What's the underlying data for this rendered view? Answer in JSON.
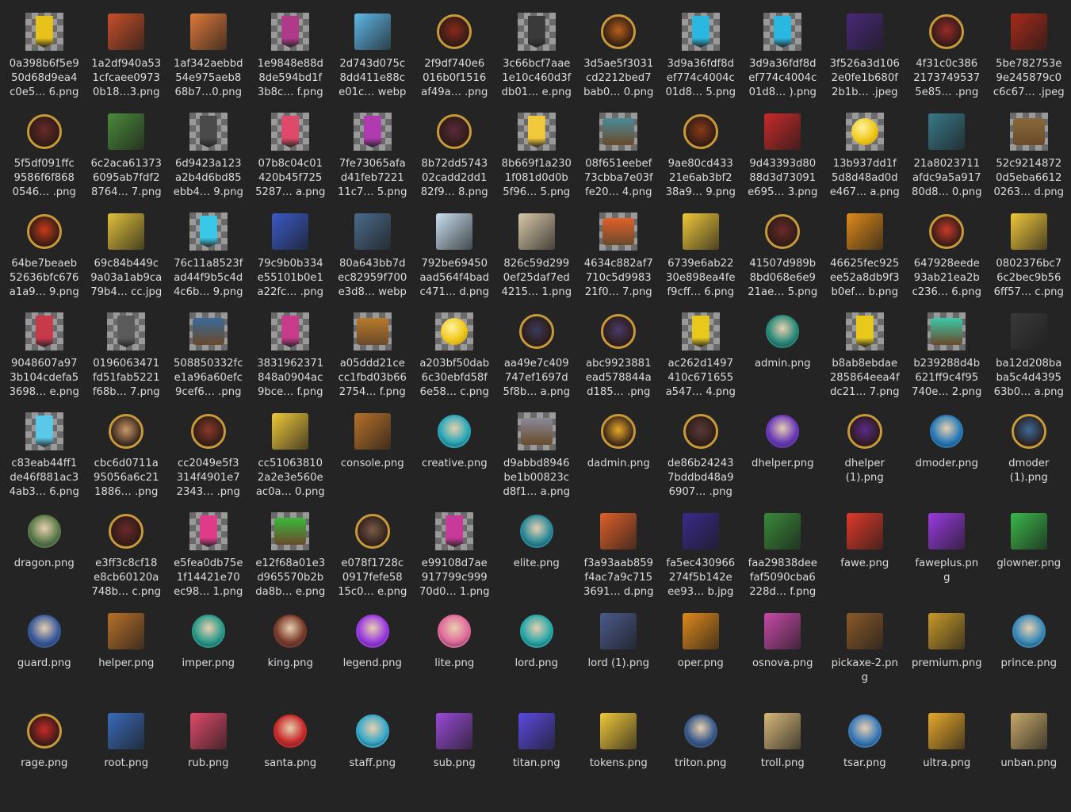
{
  "files": [
    {
      "name": "0a398b6f5e9\n50d68d9ea4\nc0e5… 6.png",
      "icon": "banner-icon",
      "color": "#e8c21a"
    },
    {
      "name": "1a2df940a53\n1cfcaee0973\n0b18…3.png",
      "icon": "character-art-icon",
      "color": "#c8502a"
    },
    {
      "name": "1af342aebbd\n54e975aeb8\n68b7…0.png",
      "icon": "logo-art-icon",
      "color": "#e07a3a"
    },
    {
      "name": "1e9848e88d\n8de594bd1f\n3b8c… f.png",
      "icon": "banner-icon",
      "color": "#b03a8a"
    },
    {
      "name": "2d743d075c\n8dd411e88c\ne01c… webp",
      "icon": "character-art-icon",
      "color": "#5fb8e8"
    },
    {
      "name": "2f9df740e6\n016b0f1516\naf49a… .png",
      "icon": "badge-icon",
      "color": "#8a2a1a"
    },
    {
      "name": "3c66bcf7aae\n1e10c460d3f\ndb01… e.png",
      "icon": "banner-icon",
      "color": "#3a3a3a"
    },
    {
      "name": "3d5ae5f3031\ncd2212bed7\nbab0… 0.png",
      "icon": "badge-icon",
      "color": "#b8601a"
    },
    {
      "name": "3d9a36fdf8d\nef774c4004c\n01d8… 5.png",
      "icon": "banner-icon",
      "color": "#2ab8e0"
    },
    {
      "name": "3d9a36fdf8d\nef774c4004c\n01d8… ).png",
      "icon": "banner-icon",
      "color": "#2ab8e0"
    },
    {
      "name": "3f526a3d106\n2e0fe1b680f\n2b1b… .jpeg",
      "icon": "character-art-icon",
      "color": "#4a2a7a"
    },
    {
      "name": "4f31c0c386\n2173749537\n5e85… .png",
      "icon": "badge-icon",
      "color": "#9a2a2a"
    },
    {
      "name": "5be782753e\n9e245879c0\nc6c67… .jpeg",
      "icon": "character-art-icon",
      "color": "#a82a1a"
    },
    {
      "name": "5f5df091ffc\n9586f6f868\n0546… .png",
      "icon": "badge-icon",
      "color": "#6a2a2a"
    },
    {
      "name": "6c2aca61373\n6095ab7fdf2\n8764… 7.png",
      "icon": "character-art-icon",
      "color": "#4a8a3a"
    },
    {
      "name": "6d9423a123\na2b4d6bd85\nebb4… 9.png",
      "icon": "banner-icon",
      "color": "#4a4a4a"
    },
    {
      "name": "07b8c04c01\n420b45f725\n5287… a.png",
      "icon": "banner-icon",
      "color": "#e04a6a"
    },
    {
      "name": "7fe73065afa\nd41feb7221\n11c7… 5.png",
      "icon": "banner-icon",
      "color": "#b03ab0"
    },
    {
      "name": "8b72dd5743\n02cadd2dd1\n82f9… 8.png",
      "icon": "badge-icon",
      "color": "#5a2a3a"
    },
    {
      "name": "8b669f1a230\n1f081d0d0b\n5f96… 5.png",
      "icon": "banner-icon",
      "color": "#f0c83a"
    },
    {
      "name": "08f651eebef\n73cbba7e03f\nfe20… 4.png",
      "icon": "chest-icon",
      "color": "#4a8a9a"
    },
    {
      "name": "9ae80cd433\n21e6ab3bf2\n38a9… 9.png",
      "icon": "badge-icon",
      "color": "#8a3a1a"
    },
    {
      "name": "9d43393d80\n88d3d73091\ne695… 3.png",
      "icon": "character-art-icon",
      "color": "#c82a2a"
    },
    {
      "name": "13b937dd1f\n5d8d48ad0d\ne467… a.png",
      "icon": "coin-icon",
      "color": "#f0c81a"
    },
    {
      "name": "21a8023711\nafdc9a5a917\n80d8… 0.png",
      "icon": "character-art-icon",
      "color": "#3a7a8a"
    },
    {
      "name": "52c9214872\n0d5eba6612\n0263… d.png",
      "icon": "chest-icon",
      "color": "#8a6a3a"
    },
    {
      "name": "64be7beaeb\n52636bfc676\na1a9… 9.png",
      "icon": "badge-icon",
      "color": "#c83a1a"
    },
    {
      "name": "69c84b449c\n9a03a1ab9ca\n79b4… cc.jpg",
      "icon": "character-art-icon",
      "color": "#e0c03a"
    },
    {
      "name": "76c11a8523f\nad44f9b5c4d\n4c6b… 9.png",
      "icon": "banner-icon",
      "color": "#3ac8e8"
    },
    {
      "name": "79c9b0b334\ne55101b0e1\na22fc… .png",
      "icon": "card-icon",
      "color": "#3a5ac8"
    },
    {
      "name": "80a643bb7d\nec82959f700\ne3d8… webp",
      "icon": "shark-icon",
      "color": "#4a6a8a"
    },
    {
      "name": "792be69450\naad564f4bad\nc471… d.png",
      "icon": "character-art-icon",
      "color": "#c8e0f0"
    },
    {
      "name": "826c59d299\n0ef25daf7ed\n4215… 1.png",
      "icon": "scroll-icon",
      "color": "#d8c8a8"
    },
    {
      "name": "4634c882af7\n710c5d9983\n21f0… 7.png",
      "icon": "chest-icon",
      "color": "#e0602a"
    },
    {
      "name": "6739e6ab22\n30e898ea4fe\nf9cff… 6.png",
      "icon": "coins-pile-icon",
      "color": "#f0c83a"
    },
    {
      "name": "41507d989b\n8bd068e6e9\n21ae… 5.png",
      "icon": "badge-icon",
      "color": "#6a2a2a"
    },
    {
      "name": "46625fec925\nee52a8db9f3\nb0ef… b.png",
      "icon": "sign-icon",
      "color": "#e08a1a"
    },
    {
      "name": "647928eede\n93ab21ea2b\nc236… 6.png",
      "icon": "badge-icon",
      "color": "#c83a2a"
    },
    {
      "name": "0802376bc7\n6c2bec9b56\n6ff57… c.png",
      "icon": "coins-pile-icon",
      "color": "#f0c83a"
    },
    {
      "name": "9048607a97\n3b104cdefa5\n3698… e.png",
      "icon": "banner-icon",
      "color": "#c83a4a"
    },
    {
      "name": "0196063471\nfd51fab5221\nf68b… 7.png",
      "icon": "banner-icon",
      "color": "#5a5a5a"
    },
    {
      "name": "508850332fc\ne1a96a60efc\n9cef6… .png",
      "icon": "chest-icon",
      "color": "#3a6a9a"
    },
    {
      "name": "3831962371\n848a0904ac\n9bce… f.png",
      "icon": "banner-icon",
      "color": "#c83a8a"
    },
    {
      "name": "a05ddd21ce\ncc1fbd03b66\n2754… f.png",
      "icon": "chest-icon",
      "color": "#b87a2a"
    },
    {
      "name": "a203bf50dab\n6c30ebfd58f\n6e58… c.png",
      "icon": "coin-icon",
      "color": "#f0c81a"
    },
    {
      "name": "aa49e7c409\n747ef1697d\n5f8b… a.png",
      "icon": "badge-icon",
      "color": "#3a3a5a"
    },
    {
      "name": "abc9923881\nead578844a\nd185… .png",
      "icon": "badge-icon",
      "color": "#4a3a6a"
    },
    {
      "name": "ac262d1497\n410c671655\na547… 4.png",
      "icon": "banner-icon",
      "color": "#e8c81a"
    },
    {
      "name": "admin.png",
      "icon": "round-avatar-icon",
      "color": "#2a8a7a"
    },
    {
      "name": "b8ab8ebdae\n285864eea4f\ndc21… 7.png",
      "icon": "banner-icon",
      "color": "#e8c81a"
    },
    {
      "name": "b239288d4b\n621ff9c4f95\n740e… 2.png",
      "icon": "chest-icon",
      "color": "#3ac8a8"
    },
    {
      "name": "ba12d208ba\nba5c4d4395\n63b0… a.png",
      "icon": "anvil-icon",
      "color": "#3a3a3a"
    },
    {
      "name": "c83eab44ff1\nde46f881ac3\n4ab3… 6.png",
      "icon": "banner-icon",
      "color": "#5ac8e8"
    },
    {
      "name": "cbc6d0711a\n95056a6c21\n1886… .png",
      "icon": "badge-icon",
      "color": "#c89a6a"
    },
    {
      "name": "cc2049e5f3\n314f4901e7\n2343… .png",
      "icon": "badge-icon",
      "color": "#8a3a2a"
    },
    {
      "name": "cc51063810\n2a2e3e560e\nac0a… 0.png",
      "icon": "coins-pile-icon",
      "color": "#f0c83a"
    },
    {
      "name": "console.png",
      "icon": "gingerbread-icon",
      "color": "#b8702a"
    },
    {
      "name": "creative.png",
      "icon": "round-avatar-icon",
      "color": "#2aa8b8"
    },
    {
      "name": "d9abbd8946\nbe1b00823c\nd8f1… a.png",
      "icon": "chest-icon",
      "color": "#8a8a9a"
    },
    {
      "name": "dadmin.png",
      "icon": "badge-icon",
      "color": "#e8a82a"
    },
    {
      "name": "de86b24243\n7bddbd48a9\n6907… .png",
      "icon": "badge-icon",
      "color": "#5a3a3a"
    },
    {
      "name": "dhelper.png",
      "icon": "hexagon-avatar-icon",
      "color": "#6a3ab8"
    },
    {
      "name": "dhelper\n(1).png",
      "icon": "badge-icon",
      "color": "#5a2a8a"
    },
    {
      "name": "dmoder.png",
      "icon": "round-avatar-icon",
      "color": "#2a7ab8"
    },
    {
      "name": "dmoder\n(1).png",
      "icon": "badge-icon",
      "color": "#3a6a9a"
    },
    {
      "name": "dragon.png",
      "icon": "round-avatar-icon",
      "color": "#5a7a4a"
    },
    {
      "name": "e3ff3c8cf18\ne8cb60120a\n748b… c.png",
      "icon": "badge-icon",
      "color": "#6a2a2a"
    },
    {
      "name": "e5fea0db75e\n1f14421e70\nec98… 1.png",
      "icon": "banner-icon",
      "color": "#e03a8a"
    },
    {
      "name": "e12f68a01e3\nd965570b2b\nda8b… e.png",
      "icon": "chest-icon",
      "color": "#3ab83a"
    },
    {
      "name": "e078f1728c\n0917fefe58\n15c0… e.png",
      "icon": "badge-icon",
      "color": "#7a5a4a"
    },
    {
      "name": "e99108d7ae\n917799c999\n70d0… 1.png",
      "icon": "banner-icon",
      "color": "#c83a9a"
    },
    {
      "name": "elite.png",
      "icon": "round-avatar-icon",
      "color": "#2a8a9a"
    },
    {
      "name": "f3a93aab859\nf4ac7a9c715\n3691… d.png",
      "icon": "logo-art-icon",
      "color": "#e0602a"
    },
    {
      "name": "fa5ec430966\n274f5b142e\nee93… b.jpg",
      "icon": "character-art-icon",
      "color": "#3a2a8a"
    },
    {
      "name": "faa29838dee\nfaf5090cba6\n228d… f.png",
      "icon": "character-art-icon",
      "color": "#3a8a3a"
    },
    {
      "name": "fawe.png",
      "icon": "gift-icon",
      "color": "#e03a2a"
    },
    {
      "name": "faweplus.pn\ng",
      "icon": "gift-icon",
      "color": "#9a3ae0"
    },
    {
      "name": "glowner.png",
      "icon": "character-art-icon",
      "color": "#3ab84a"
    },
    {
      "name": "guard.png",
      "icon": "round-avatar-icon",
      "color": "#3a5a9a"
    },
    {
      "name": "helper.png",
      "icon": "gingerbread-icon",
      "color": "#b8702a"
    },
    {
      "name": "imper.png",
      "icon": "round-avatar-icon",
      "color": "#2a9a8a"
    },
    {
      "name": "king.png",
      "icon": "round-avatar-icon",
      "color": "#7a3a2a"
    },
    {
      "name": "legend.png",
      "icon": "hexagon-avatar-icon",
      "color": "#9a3ae0"
    },
    {
      "name": "lite.png",
      "icon": "round-avatar-icon",
      "color": "#e06a9a"
    },
    {
      "name": "lord.png",
      "icon": "round-avatar-icon",
      "color": "#2aa8a8"
    },
    {
      "name": "lord (1).png",
      "icon": "character-art-icon",
      "color": "#4a5a8a"
    },
    {
      "name": "oper.png",
      "icon": "crossbow-icon",
      "color": "#e08a1a"
    },
    {
      "name": "osnova.png",
      "icon": "gift-icon",
      "color": "#c84aa8"
    },
    {
      "name": "pickaxe-2.pn\ng",
      "icon": "pickaxe-icon",
      "color": "#8a5a2a"
    },
    {
      "name": "premium.png",
      "icon": "shield-icon",
      "color": "#c89a2a"
    },
    {
      "name": "prince.png",
      "icon": "round-avatar-icon",
      "color": "#3a8ab8"
    },
    {
      "name": "rage.png",
      "icon": "badge-icon",
      "color": "#c82a2a"
    },
    {
      "name": "root.png",
      "icon": "shield-icon",
      "color": "#3a6ab8"
    },
    {
      "name": "rub.png",
      "icon": "money-bag-icon",
      "color": "#e04a6a"
    },
    {
      "name": "santa.png",
      "icon": "round-avatar-icon",
      "color": "#c82a2a"
    },
    {
      "name": "staff.png",
      "icon": "round-avatar-icon",
      "color": "#3aa8c8"
    },
    {
      "name": "sub.png",
      "icon": "wizard-hat-icon",
      "color": "#9a4ad8"
    },
    {
      "name": "titan.png",
      "icon": "potion-icon",
      "color": "#5a4ae0"
    },
    {
      "name": "tokens.png",
      "icon": "coins-pile-icon",
      "color": "#f0c83a"
    },
    {
      "name": "triton.png",
      "icon": "round-avatar-icon",
      "color": "#3a5a8a"
    },
    {
      "name": "troll.png",
      "icon": "scroll-icon",
      "color": "#d8b87a"
    },
    {
      "name": "tsar.png",
      "icon": "round-avatar-icon",
      "color": "#3a7ab8"
    },
    {
      "name": "ultra.png",
      "icon": "shield-icon",
      "color": "#e8a82a"
    },
    {
      "name": "unban.png",
      "icon": "scroll-icon",
      "color": "#c8a86a"
    }
  ]
}
